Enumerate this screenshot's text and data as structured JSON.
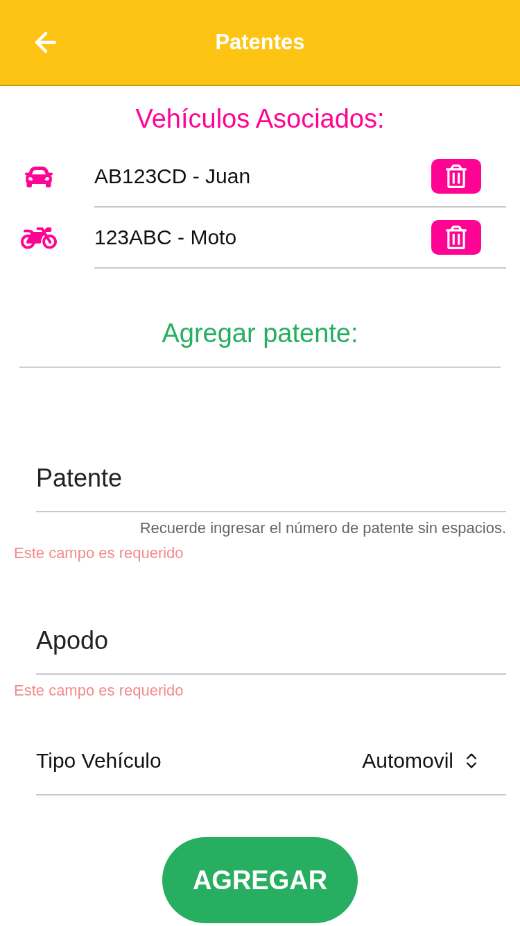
{
  "header": {
    "title": "Patentes"
  },
  "vehicles_title": "Vehículos Asociados:",
  "vehicles": [
    {
      "kind": "car",
      "label": "AB123CD - Juan"
    },
    {
      "kind": "motorcycle",
      "label": "123ABC - Moto"
    }
  ],
  "add_title": "Agregar patente:",
  "fields": [
    {
      "placeholder": "Patente",
      "hint": "Recuerde ingresar el número de patente sin espacios.",
      "error": "Este campo es requerido"
    },
    {
      "placeholder": "Apodo",
      "error": "Este campo es requerido"
    }
  ],
  "select": {
    "label": "Tipo Vehículo",
    "value": "Automovil"
  },
  "submit": "AGREGAR"
}
